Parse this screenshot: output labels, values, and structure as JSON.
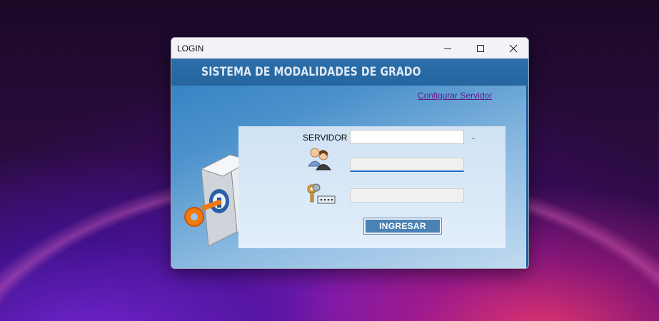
{
  "window": {
    "title": "LOGIN",
    "controls": {
      "minimize_icon": "minimize-icon",
      "maximize_icon": "maximize-icon",
      "close_icon": "close-icon"
    }
  },
  "banner": {
    "title": "SISTEMA DE MODALIDADES DE GRADO"
  },
  "links": {
    "configure_server": "Configurar Servidor"
  },
  "form": {
    "servidor_label": "SERVIDOR",
    "servidor_value": "",
    "servidor_suffix": "..",
    "usuario_value": "",
    "clave_value": "",
    "submit_label": "INGRESAR",
    "user_icon": "users-icon",
    "key_icon": "keys-icon"
  },
  "colors": {
    "banner": "#2566a0",
    "link": "#5a1d8a",
    "button": "#4a82b6",
    "focus_underline": "#1e6fc8"
  }
}
